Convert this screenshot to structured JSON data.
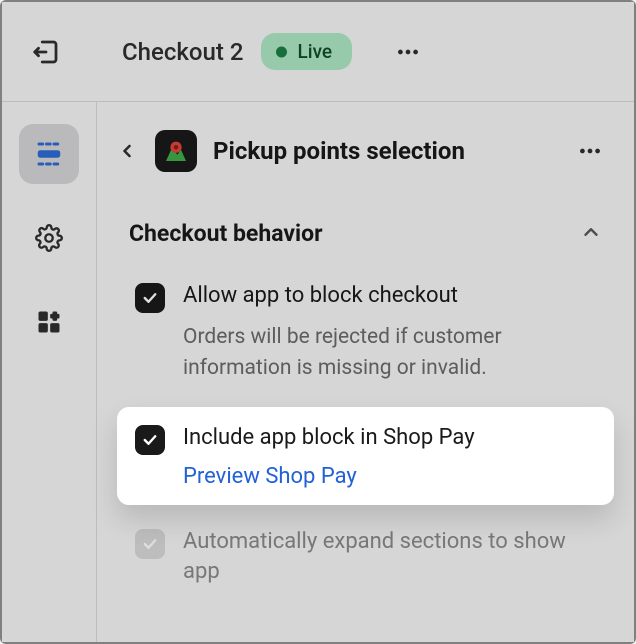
{
  "topbar": {
    "title": "Checkout 2",
    "badge": "Live"
  },
  "panel": {
    "title": "Pickup points selection",
    "section": "Checkout behavior",
    "options": {
      "allow_block": {
        "label": "Allow app to block checkout",
        "desc": "Orders will be rejected if customer information is missing or invalid."
      },
      "include_shop_pay": {
        "label": "Include app block in Shop Pay",
        "link": "Preview Shop Pay"
      },
      "auto_expand": {
        "label": "Automatically expand sections to show app"
      }
    }
  }
}
